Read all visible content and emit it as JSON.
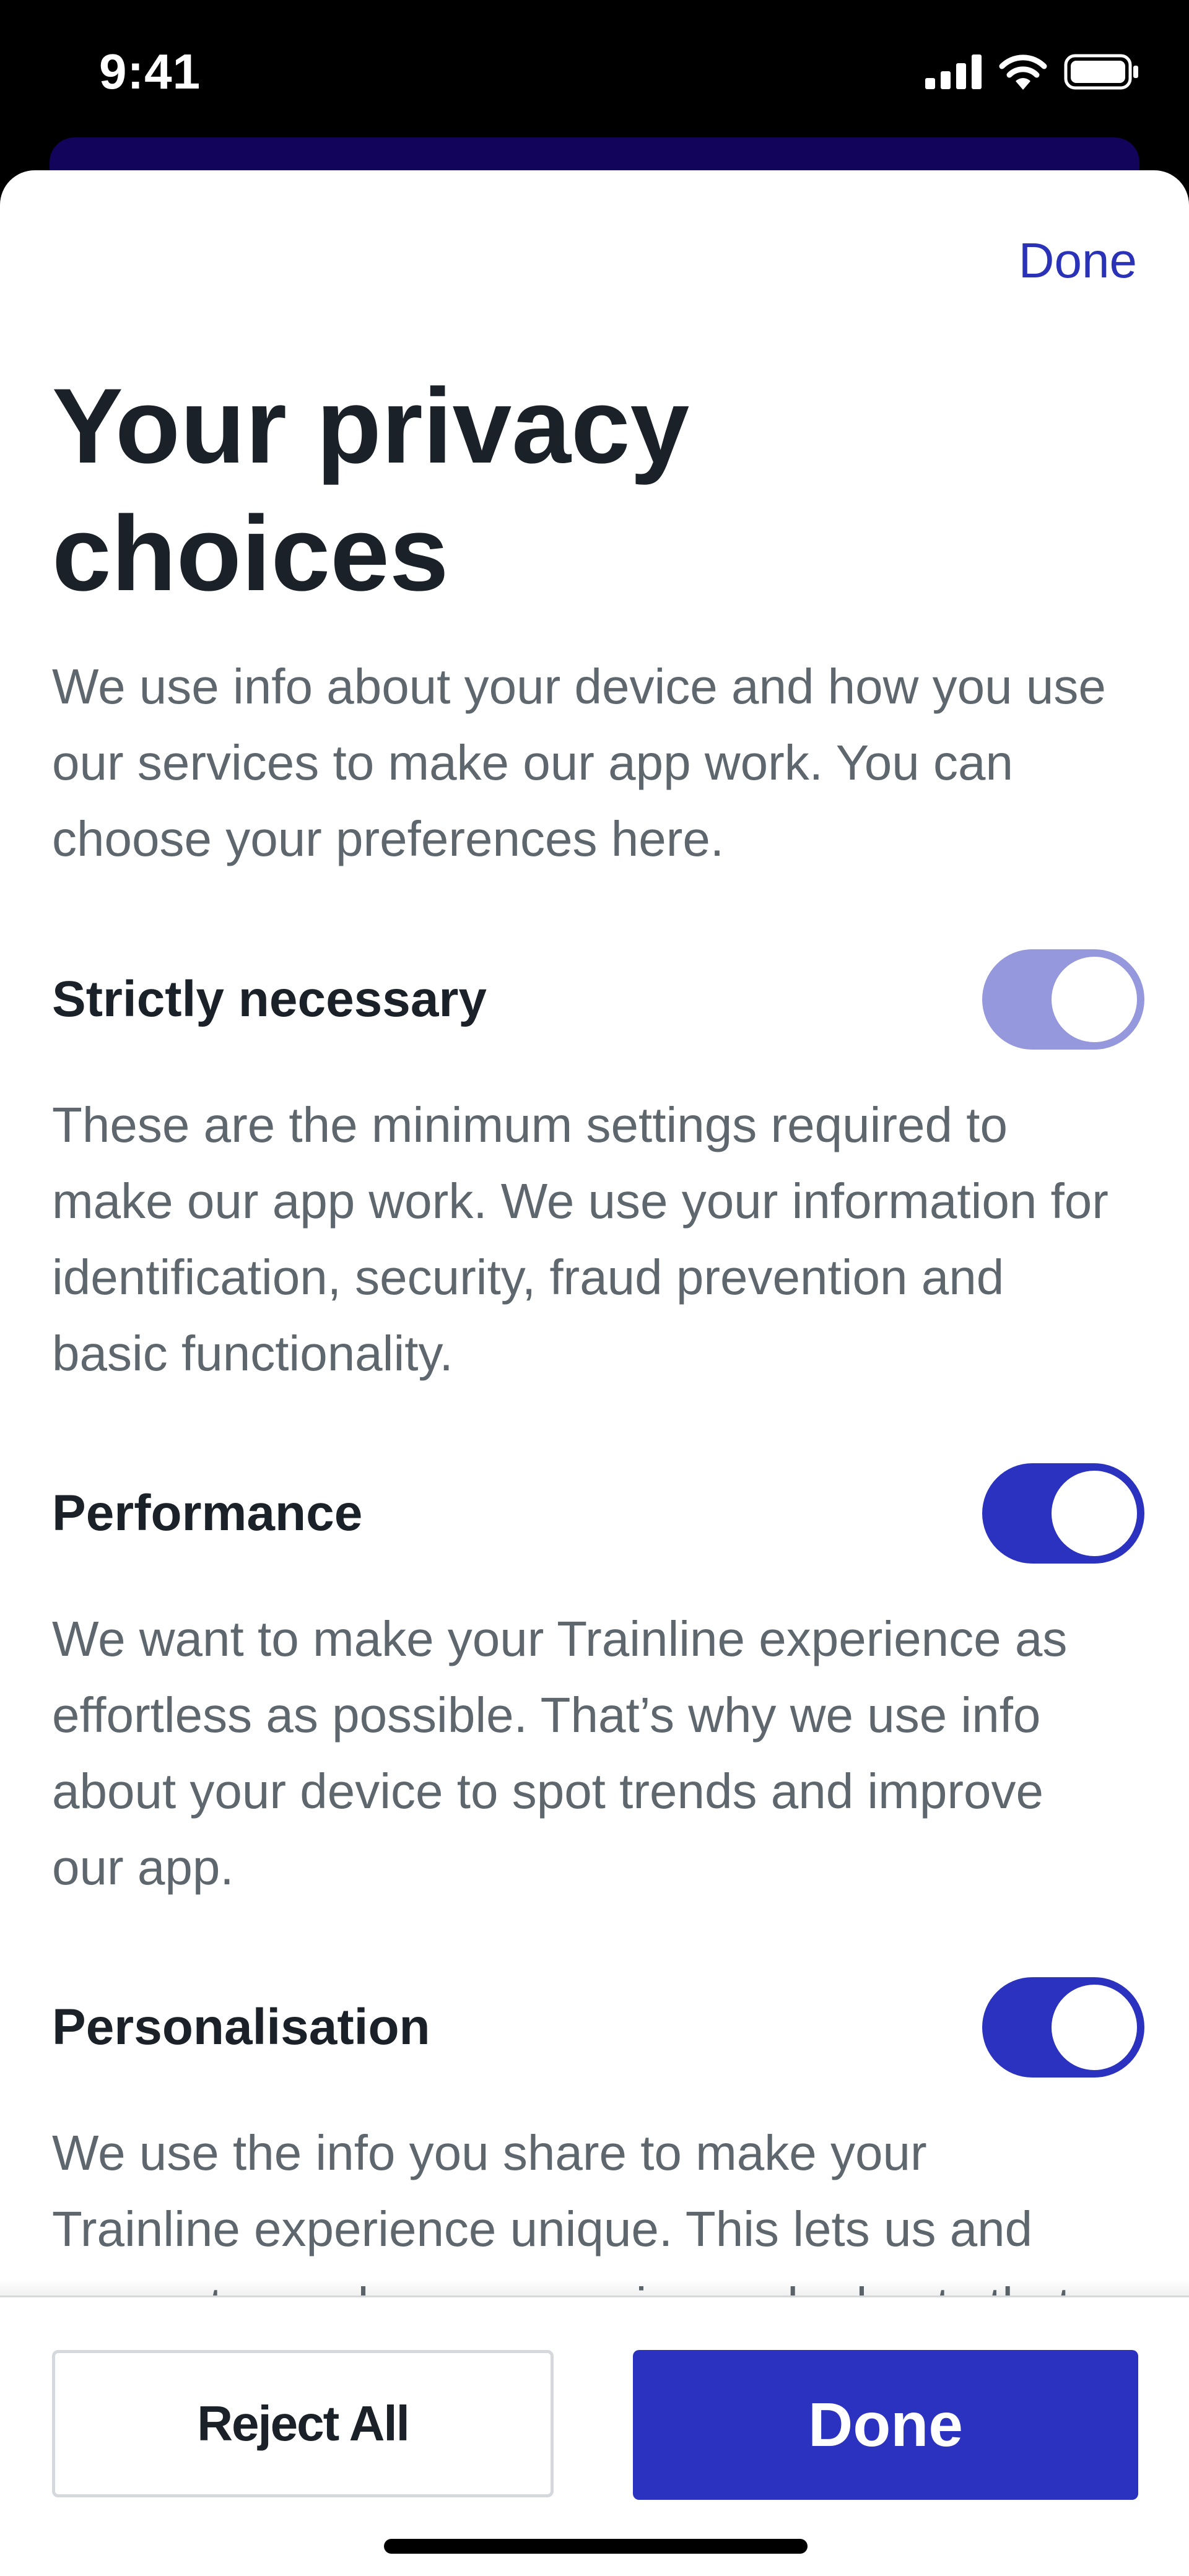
{
  "status_bar": {
    "time": "9:41",
    "icons": [
      "signal-icon",
      "wifi-icon",
      "battery-icon"
    ]
  },
  "sheet": {
    "done_link": "Done",
    "title": "Your privacy choices",
    "intro": "We use info about your device and how you use our services to make our app work. You can choose your preferences here."
  },
  "sections": [
    {
      "title": "Strictly necessary",
      "description": "These are the minimum settings required to make our app work. We use your information for identification, security, fraud prevention and basic functionality.",
      "enabled": true,
      "locked": true
    },
    {
      "title": "Performance",
      "description": "We want to make your Trainline experience as effortless as possible. That’s why we use info about your device to spot trends and improve our app.",
      "enabled": true,
      "locked": false
    },
    {
      "title": "Personalisation",
      "description": "We use the info you share to make your Trainline experience unique. This lets us and our partners show messaging and adverts that",
      "enabled": true,
      "locked": false
    }
  ],
  "footer": {
    "reject_label": "Reject All",
    "done_label": "Done"
  },
  "colors": {
    "accent": "#2a32bf",
    "toggle_locked": "#9598dc",
    "title_text": "#1b2128",
    "body_text": "#5e676e"
  }
}
